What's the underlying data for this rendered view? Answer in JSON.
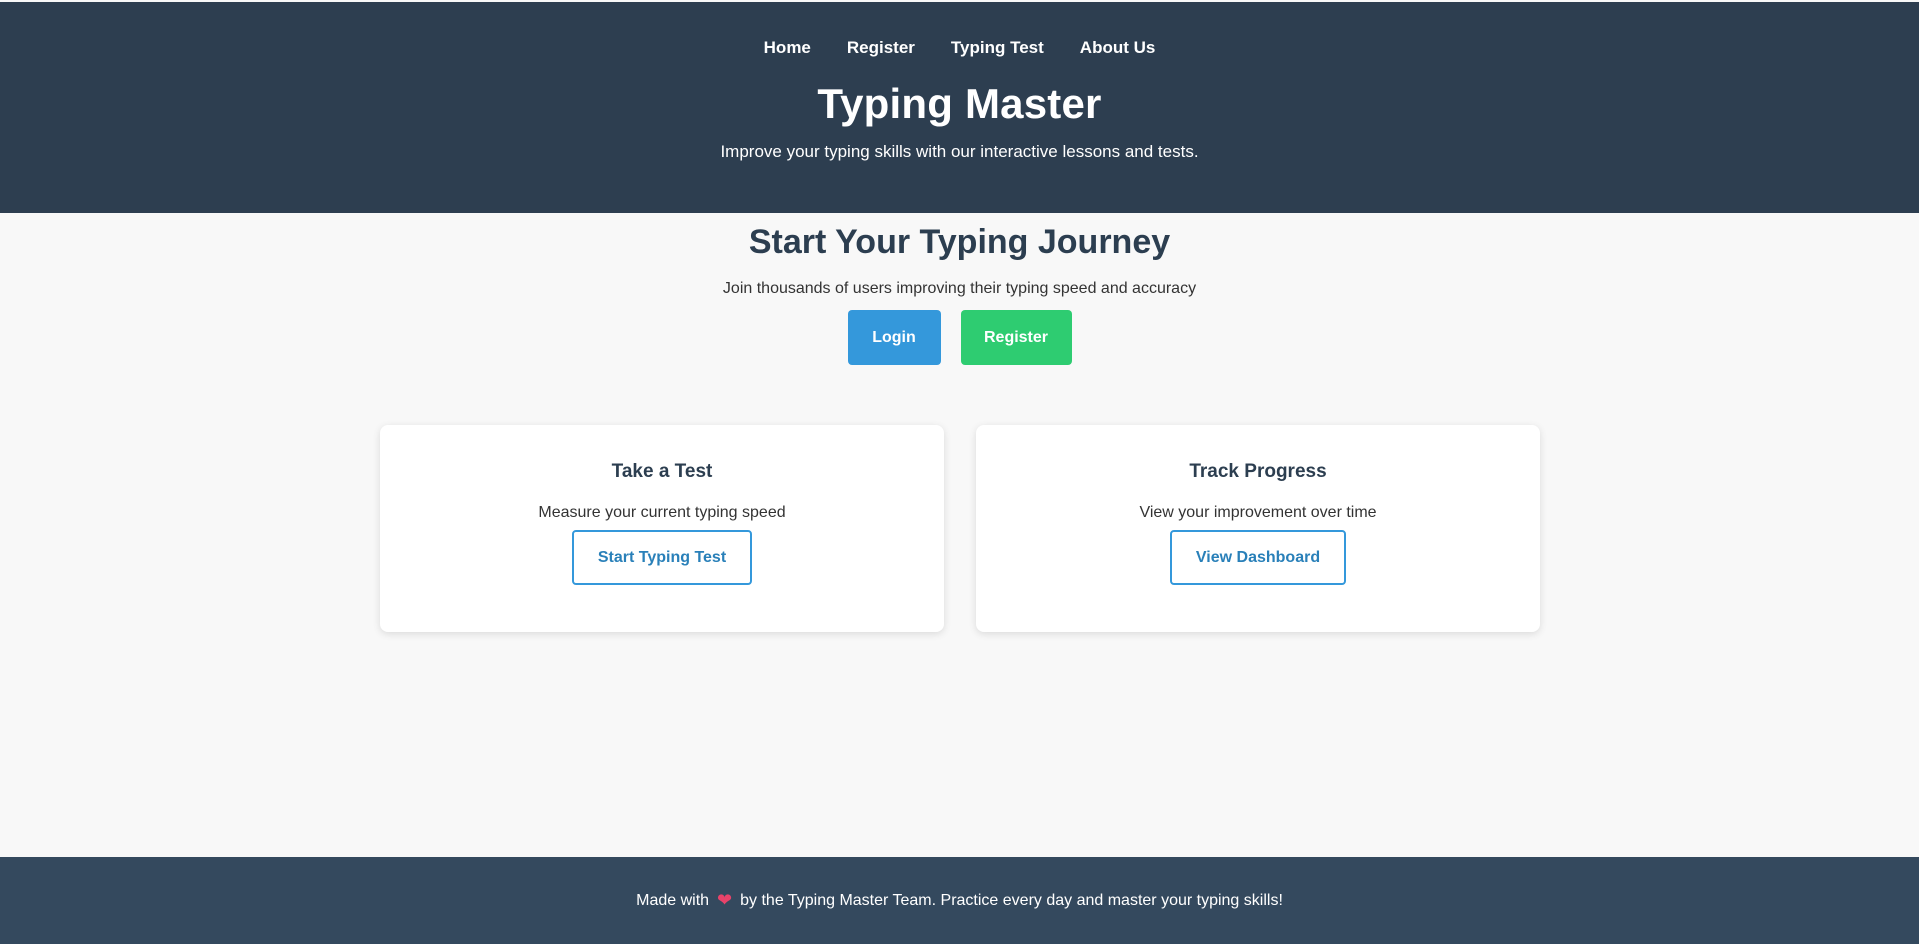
{
  "nav": {
    "items": [
      {
        "label": "Home"
      },
      {
        "label": "Register"
      },
      {
        "label": "Typing Test"
      },
      {
        "label": "About Us"
      }
    ]
  },
  "header": {
    "title": "Typing Master",
    "tagline": "Improve your typing skills with our interactive lessons and tests."
  },
  "hero": {
    "title": "Start Your Typing Journey",
    "subtitle": "Join thousands of users improving their typing speed and accuracy",
    "login_label": "Login",
    "register_label": "Register"
  },
  "cards": [
    {
      "title": "Take a Test",
      "text": "Measure your current typing speed",
      "button_label": "Start Typing Test"
    },
    {
      "title": "Track Progress",
      "text": "View your improvement over time",
      "button_label": "View Dashboard"
    }
  ],
  "footer": {
    "text_before": "Made with",
    "heart_icon": "heart-icon",
    "text_after": "by the Typing Master Team. Practice every day and master your typing skills!"
  },
  "colors": {
    "header_bg": "#2d3e50",
    "footer_bg": "#34495e",
    "primary": "#3498db",
    "success": "#2ecc71",
    "heart": "#e8436a"
  }
}
